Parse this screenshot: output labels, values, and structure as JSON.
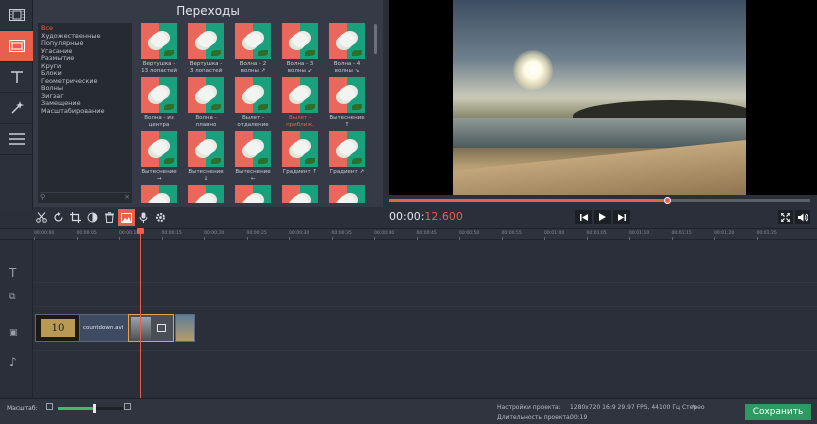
{
  "panel": {
    "title": "Переходы",
    "categories": [
      "Все",
      "Художественные",
      "Популярные",
      "Угасание",
      "Размытие",
      "Круги",
      "Блоки",
      "Геометрические",
      "Волны",
      "Зигзаг",
      "Замещение",
      "Масштабирование"
    ],
    "search_clear": "×",
    "transitions": [
      [
        "Вертушка -",
        "13 лопастей"
      ],
      [
        "Вертушка -",
        "3 лопастей"
      ],
      [
        "Волна - 2",
        "волны ↗"
      ],
      [
        "Волна - 3",
        "волны ↙"
      ],
      [
        "Волна - 4",
        "волны ↘"
      ],
      [
        "Волна - из",
        "центра"
      ],
      [
        "Волна -",
        "плавно"
      ],
      [
        "Вылет -",
        "отдаление"
      ],
      [
        "Вылет -",
        "приближ."
      ],
      [
        "Вытеснение",
        "↑"
      ],
      [
        "Вытеснение",
        "→"
      ],
      [
        "Вытеснение",
        "↓"
      ],
      [
        "Вытеснение",
        "←"
      ],
      [
        "Градиент ↑",
        ""
      ],
      [
        "Градиент ↗",
        ""
      ]
    ]
  },
  "player": {
    "timecode_main": "00:00:",
    "timecode_ms": "12.600",
    "progress": 0.66
  },
  "ruler": {
    "ticks": [
      "00:00:00",
      "00:00:05",
      "00:00:10",
      "00:00:15",
      "00:00:20",
      "00:00:25",
      "00:00:30",
      "00:00:35",
      "00:00:40",
      "00:00:45",
      "00:00:50",
      "00:00:55",
      "00:01:00",
      "00:01:05",
      "00:01:10",
      "00:01:15",
      "00:01:20",
      "00:01:25"
    ]
  },
  "timeline": {
    "clip1_name": "countdown.avi",
    "clip1_frame": "10"
  },
  "bottom": {
    "zoom_label": "Масштаб:",
    "zoom_level": 0.55,
    "settings_label": "Настройки проекта:",
    "settings_value": "1280x720 16:9 29.97 FPS, 44100 Гц Стерео",
    "duration_label": "Длительность проекта:",
    "duration_value": "00:19",
    "save_label": "Сохранить"
  },
  "colors": {
    "accent": "#e8604c",
    "save": "#2e9a61"
  }
}
